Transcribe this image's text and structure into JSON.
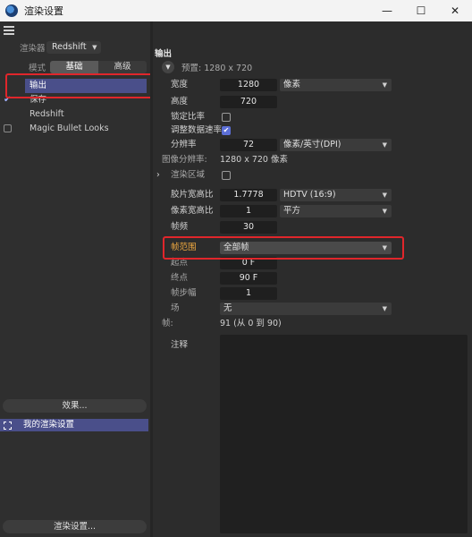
{
  "window": {
    "title": "渲染设置",
    "controls": [
      "—",
      "☐",
      "✕"
    ]
  },
  "left": {
    "renderer_label": "渲染器",
    "renderer_value": "Redshift",
    "mode_label": "模式",
    "mode_tabs": [
      "基础",
      "高级"
    ],
    "active_mode": "基础",
    "items": [
      {
        "label": "输出",
        "checked": null,
        "selected": true
      },
      {
        "label": "保存",
        "checked": true,
        "selected": false
      },
      {
        "label": "Redshift",
        "checked": null,
        "selected": false
      },
      {
        "label": "Magic Bullet Looks",
        "checked": false,
        "selected": false
      }
    ],
    "effects_button": "效果...",
    "my_settings": "我的渲染设置",
    "render_settings_button": "渲染设置..."
  },
  "right": {
    "section_title": "输出",
    "preset": "预置: 1280 x 720",
    "width_label": "宽度",
    "width_value": "1280",
    "width_unit": "像素",
    "height_label": "高度",
    "height_value": "720",
    "lock_ratio_label": "锁定比率",
    "adjust_data_rate_label": "调整数据速率",
    "resolution_label": "分辨率",
    "resolution_value": "72",
    "resolution_unit": "像素/英寸(DPI)",
    "image_resolution_label": "图像分辨率:",
    "image_resolution_value": "1280 x 720 像素",
    "render_region_label": "渲染区域",
    "film_aspect_label": "胶片宽高比",
    "film_aspect_value": "1.7778",
    "film_aspect_preset": "HDTV (16:9)",
    "pixel_aspect_label": "像素宽高比",
    "pixel_aspect_value": "1",
    "pixel_aspect_preset": "平方",
    "fps_label": "帧频",
    "fps_value": "30",
    "frame_range_label": "帧范围",
    "frame_range_value": "全部帧",
    "start_label": "起点",
    "start_value": "0 F",
    "end_label": "终点",
    "end_value": "90 F",
    "step_label": "帧步幅",
    "step_value": "1",
    "field_label": "场",
    "field_value": "无",
    "frames_label": "帧:",
    "frames_value": "91 (从 0 到 90)",
    "notes_label": "注释"
  }
}
